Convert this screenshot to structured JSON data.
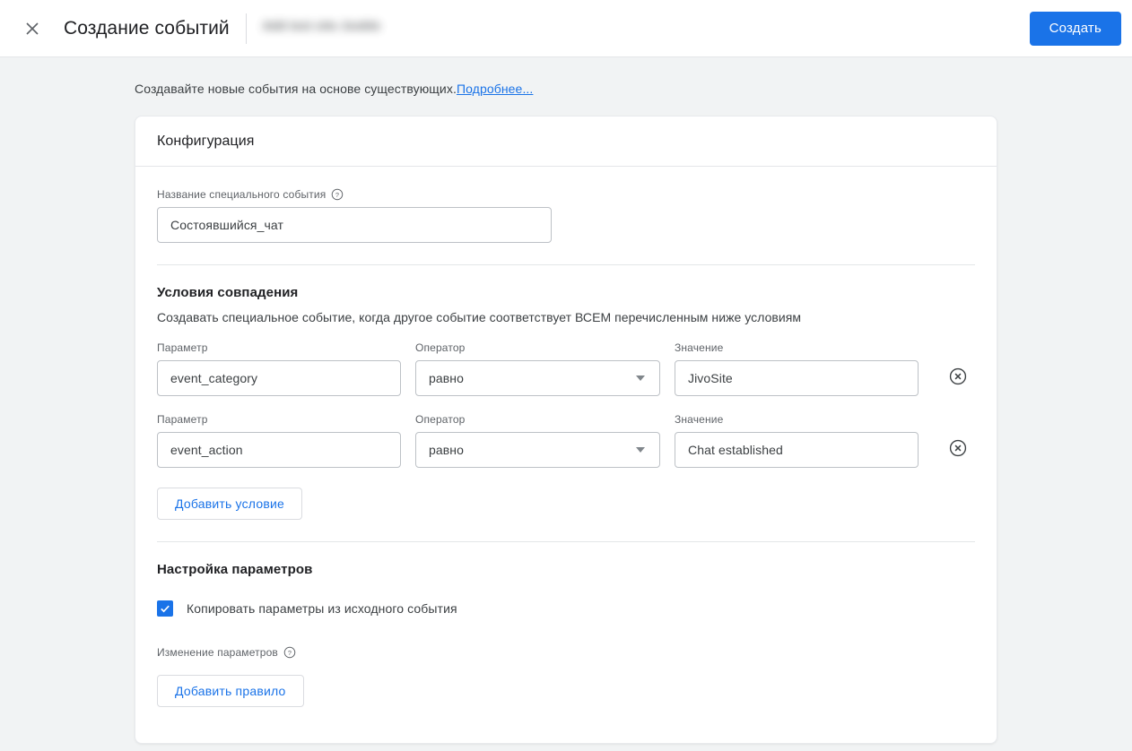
{
  "appbar": {
    "close_icon": "close-icon",
    "title": "Создание событий",
    "account_line1": "Add test site Jooble",
    "account_line2": "",
    "create_label": "Создать"
  },
  "intro": {
    "text": "Создавайте новые события на основе существующих.",
    "link_text": "Подробнее..."
  },
  "card": {
    "header_title": "Конфигурация",
    "event_name": {
      "label": "Название специального события",
      "help_icon": "help-icon",
      "value": "Состоявшийся_чат",
      "placeholder": ""
    },
    "match_conditions": {
      "title": "Условия совпадения",
      "description": "Создавать специальное событие, когда другое событие соответствует ВСЕМ перечисленным ниже условиям",
      "labels": {
        "parameter": "Параметр",
        "operator": "Оператор",
        "value": "Значение"
      },
      "rows": [
        {
          "parameter": "event_category",
          "operator": "равно",
          "value": "JivoSite",
          "remove_icon": "remove-circle-icon"
        },
        {
          "parameter": "event_action",
          "operator": "равно",
          "value": "Chat established",
          "remove_icon": "remove-circle-icon"
        }
      ],
      "add_condition_label": "Добавить условие"
    },
    "parameter_config": {
      "title": "Настройка параметров",
      "copy_checkbox_label": "Копировать параметры из исходного события",
      "copy_checkbox_checked": true,
      "modify_label": "Изменение параметров",
      "modify_help_icon": "help-icon",
      "add_rule_label": "Добавить правило"
    }
  },
  "colors": {
    "accent": "#1a73e8",
    "page_background": "#f1f3f4",
    "card_background": "#ffffff",
    "text_primary": "#202124",
    "text_secondary": "#5f6368",
    "border": "#bdc1c6"
  }
}
